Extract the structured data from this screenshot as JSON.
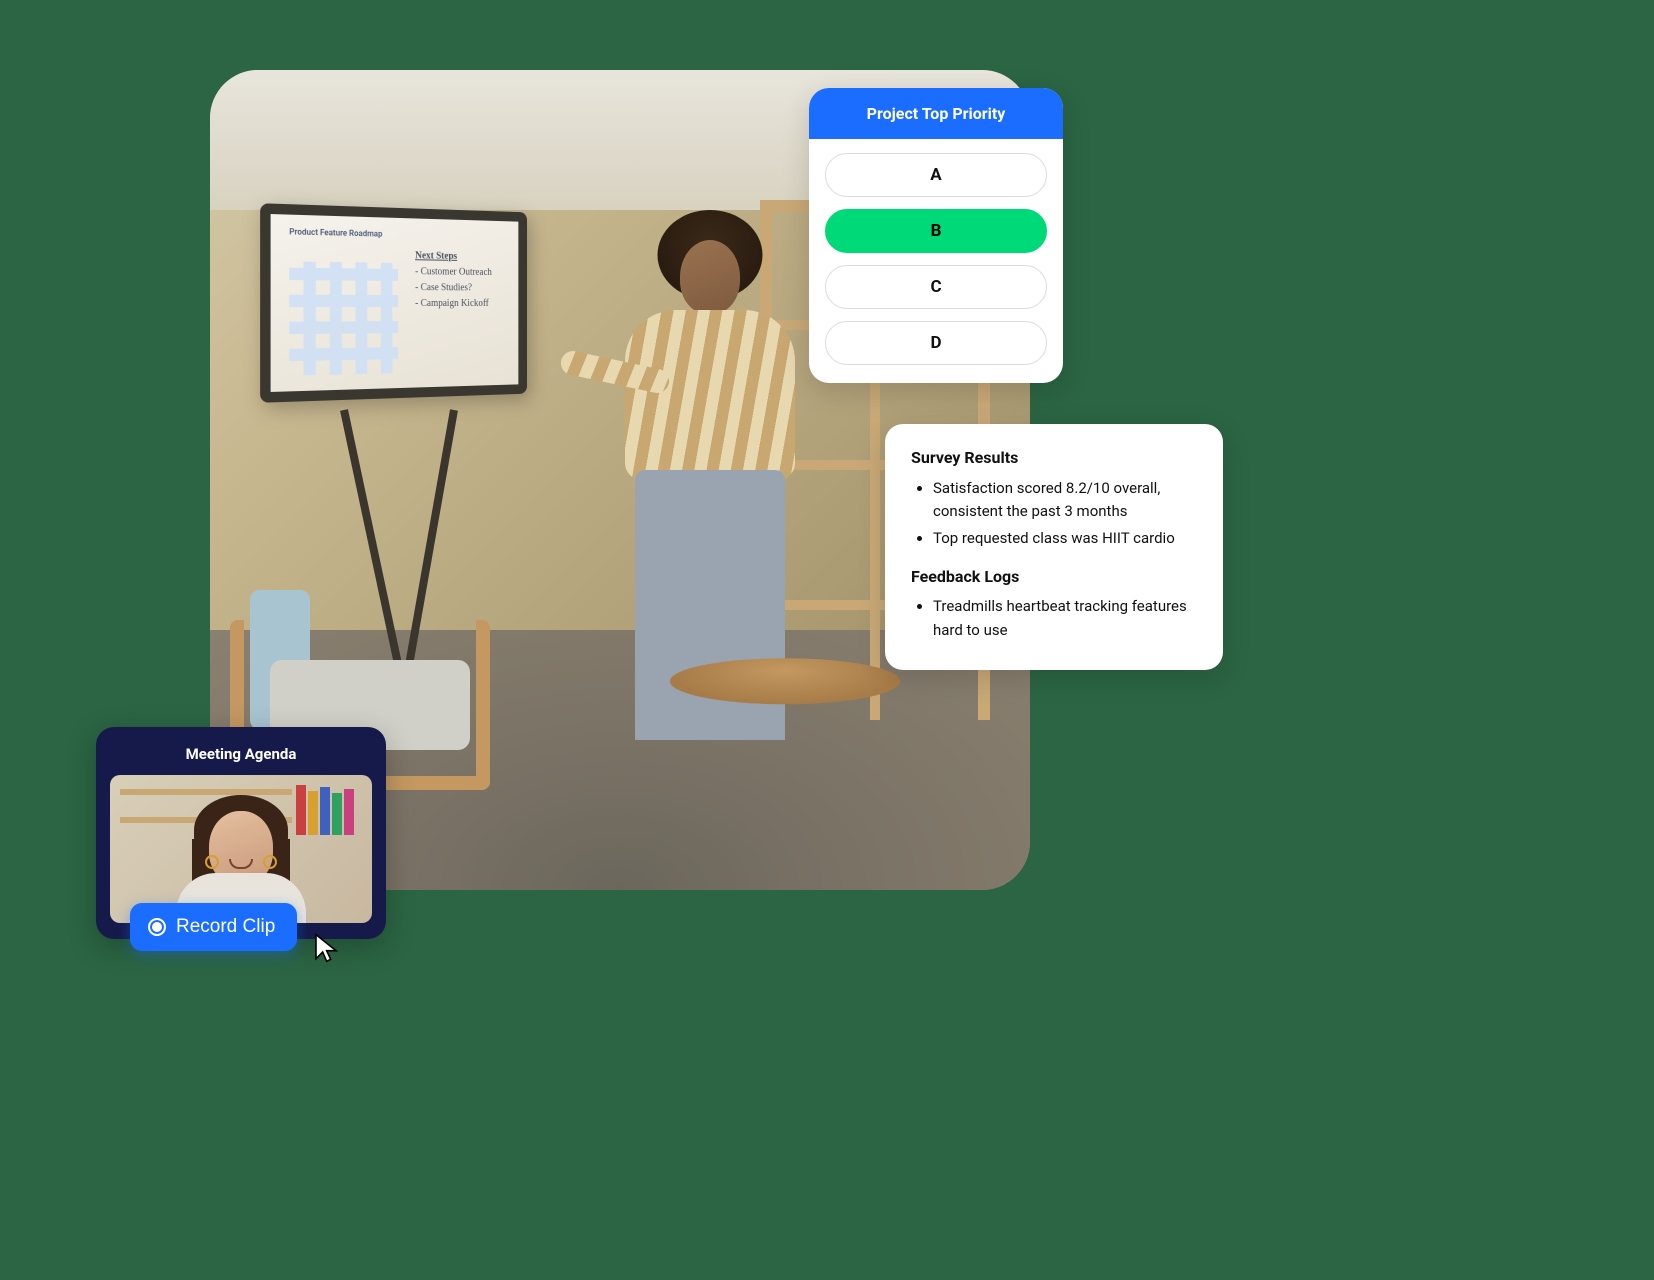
{
  "whiteboard": {
    "title": "Product Feature Roadmap",
    "notes_heading": "Next Steps",
    "notes": [
      "Customer Outreach",
      "Case Studies?",
      "Campaign Kickoff"
    ]
  },
  "poll": {
    "title": "Project Top Priority",
    "options": [
      {
        "label": "A",
        "selected": false
      },
      {
        "label": "B",
        "selected": true
      },
      {
        "label": "C",
        "selected": false
      },
      {
        "label": "D",
        "selected": false
      }
    ]
  },
  "results": {
    "section1_title": "Survey Results",
    "section1_items": [
      "Satisfaction scored 8.2/10 overall, consistent the past 3 months",
      "Top requested class was HIIT cardio"
    ],
    "section2_title": "Feedback Logs",
    "section2_items": [
      "Treadmills heartbeat tracking features hard to use"
    ]
  },
  "agenda": {
    "title": "Meeting Agenda",
    "record_label": "Record Clip"
  },
  "colors": {
    "primary_blue": "#1a6dff",
    "selected_green": "#00d977",
    "card_navy": "#151a4a",
    "page_bg": "#2b6543"
  }
}
